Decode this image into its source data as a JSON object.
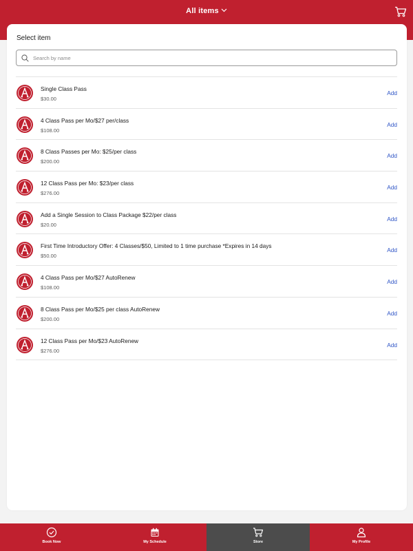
{
  "header": {
    "title": "All items",
    "title_icon": "chevron-down-icon",
    "cart_icon": "cart-icon"
  },
  "card": {
    "title": "Select item",
    "search": {
      "placeholder": "Search by name",
      "value": "",
      "icon": "search-icon"
    }
  },
  "items": [
    {
      "name": "Single Class Pass",
      "price": "$30.00",
      "action": "Add"
    },
    {
      "name": "4 Class Pass per Mo/$27 per/class",
      "price": "$108.00",
      "action": "Add"
    },
    {
      "name": "8 Class Passes per Mo: $25/per class",
      "price": "$200.00",
      "action": "Add"
    },
    {
      "name": "12 Class Pass per Mo: $23/per class",
      "price": "$276.00",
      "action": "Add"
    },
    {
      "name": "Add a Single Session to Class Package $22/per class",
      "price": "$20.00",
      "action": "Add"
    },
    {
      "name": "First Time Introductory Offer: 4 Classes/$50, Limited to 1 time purchase *Expires in 14 days",
      "price": "$50.00",
      "action": "Add"
    },
    {
      "name": "4 Class Pass per Mo/$27 AutoRenew",
      "price": "$108.00",
      "action": "Add"
    },
    {
      "name": "8 Class Pass per Mo/$25 per class AutoRenew",
      "price": "$200.00",
      "action": "Add"
    },
    {
      "name": "12 Class Pass per Mo/$23 AutoRenew",
      "price": "$276.00",
      "action": "Add"
    }
  ],
  "bottom_nav": [
    {
      "label": "Book Now",
      "icon": "check-circle-icon",
      "active": false
    },
    {
      "label": "My Schedule",
      "icon": "calendar-icon",
      "active": false
    },
    {
      "label": "Store",
      "icon": "cart-icon",
      "active": true
    },
    {
      "label": "My Profile",
      "icon": "person-icon",
      "active": false
    }
  ],
  "colors": {
    "brand_red": "#c0202f",
    "active_tab": "#4c4c4c",
    "link_blue": "#2f55c6"
  }
}
